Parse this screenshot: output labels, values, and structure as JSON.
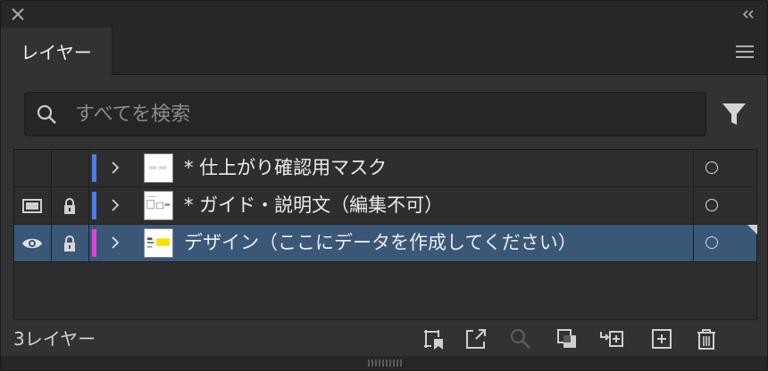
{
  "panel": {
    "tab_label": "レイヤー",
    "search_placeholder": "すべてを検索",
    "layer_count": "3レイヤー"
  },
  "layers": [
    {
      "name": "* 仕上がり確認用マスク",
      "color": "#4a7cf0",
      "visible_icon": "none",
      "locked": false,
      "selected": false
    },
    {
      "name": "* ガイド・説明文（編集不可）",
      "color": "#4a7cf0",
      "visible_icon": "preview-box-icon",
      "locked": true,
      "selected": false
    },
    {
      "name": "デザイン（ここにデータを作成してください）",
      "color": "#e040e0",
      "visible_icon": "eye-icon",
      "locked": true,
      "selected": true
    }
  ],
  "colors": {
    "panel_bg": "#323232",
    "selected_row": "#3a5778"
  }
}
